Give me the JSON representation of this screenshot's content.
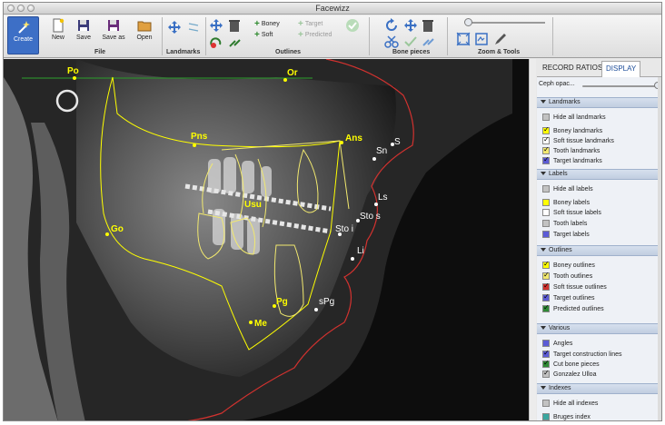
{
  "window": {
    "title": "Facewizz"
  },
  "toolbar": {
    "create": "Create",
    "file": {
      "group": "File",
      "new": "New",
      "save": "Save",
      "save_as": "Save as",
      "open": "Open"
    },
    "landmarks": {
      "group": "Landmarks"
    },
    "outlines": {
      "group": "Outlines",
      "boney": "Boney",
      "soft": "Soft",
      "target": "Target",
      "predicted": "Predicted"
    },
    "bone_pieces": {
      "group": "Bone pieces"
    },
    "zoom_tools": {
      "group": "Zoom & Tools"
    }
  },
  "xray": {
    "labels": {
      "po": "Po",
      "or": "Or",
      "pns": "Pns",
      "ans": "Ans",
      "sn": "Sn",
      "s": "S",
      "ls": "Ls",
      "sto_s": "Sto s",
      "sto_i": "Sto i",
      "li": "Li",
      "go": "Go",
      "pg": "Pg",
      "spg": "sPg",
      "me": "Me",
      "u": "Usu"
    }
  },
  "panel": {
    "tabs": [
      "RECORD",
      "RATIOS",
      "DISPLAY"
    ],
    "ceph_opacity": "Ceph opac...",
    "sections": {
      "landmarks": {
        "title": "Landmarks",
        "items": [
          "Hide all landmarks",
          "Boney landmarks",
          "Soft tissue landmarks",
          "Tooth landmarks",
          "Target landmarks"
        ],
        "checked": [
          false,
          true,
          true,
          true,
          true
        ]
      },
      "labels": {
        "title": "Labels",
        "items": [
          "Hide all labels",
          "Boney labels",
          "Soft tissue labels",
          "Tooth labels",
          "Target labels"
        ],
        "checked": [
          false,
          false,
          false,
          false,
          false
        ]
      },
      "outlines": {
        "title": "Outlines",
        "items": [
          "Boney outlines",
          "Tooth outlines",
          "Soft tissue outlines",
          "Target outlines",
          "Predicted outlines"
        ],
        "checked": [
          true,
          true,
          true,
          true,
          true
        ]
      },
      "various": {
        "title": "Various",
        "items": [
          "Angles",
          "Target construction lines",
          "Cut bone pieces",
          "Gonzalez Ulloa"
        ],
        "checked": [
          false,
          true,
          true,
          true
        ]
      },
      "indexes": {
        "title": "Indexes",
        "items": [
          "Hide all indexes",
          "Bruges index"
        ],
        "checked": [
          false,
          false
        ]
      }
    }
  },
  "colors": {
    "boney": "#ffff00",
    "tooth": "#f2e96f",
    "soft_tissue": "#d2322f",
    "target": "#5b5bd6",
    "predicted": "#2e8a35",
    "hide": "#c2c2c2"
  }
}
